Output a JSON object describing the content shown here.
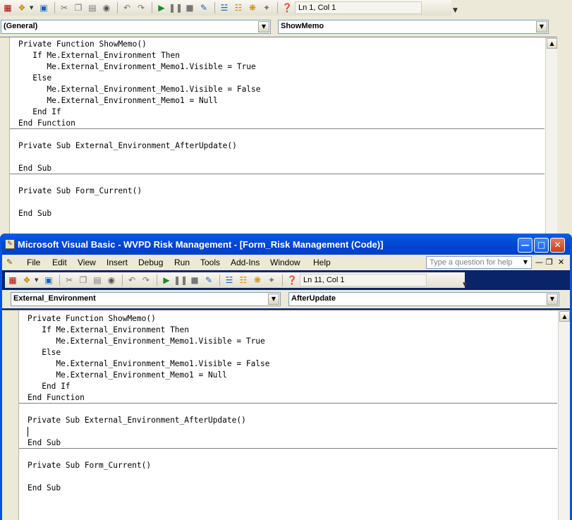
{
  "back_window": {
    "status": "Ln 1, Col 1",
    "object_combo": "(General)",
    "procedure_combo": "ShowMemo",
    "code_blocks": [
      "Private Function ShowMemo()\n   If Me.External_Environment Then\n      Me.External_Environment_Memo1.Visible = True\n   Else\n      Me.External_Environment_Memo1.Visible = False\n      Me.External_Environment_Memo1 = Null\n   End If\nEnd Function",
      "Private Sub External_Environment_AfterUpdate()\n\nEnd Sub",
      "Private Sub Form_Current()\n\nEnd Sub"
    ]
  },
  "front_window": {
    "title": "Microsoft Visual Basic - WVPD Risk Management - [Form_Risk Management (Code)]",
    "menu": [
      "File",
      "Edit",
      "View",
      "Insert",
      "Debug",
      "Run",
      "Tools",
      "Add-Ins",
      "Window",
      "Help"
    ],
    "help_placeholder": "Type a question for help",
    "status": "Ln 11, Col 1",
    "object_combo": "External_Environment",
    "procedure_combo": "AfterUpdate",
    "code_blocks": [
      "Private Function ShowMemo()\n   If Me.External_Environment Then\n      Me.External_Environment_Memo1.Visible = True\n   Else\n      Me.External_Environment_Memo1.Visible = False\n      Me.External_Environment_Memo1 = Null\n   End If\nEnd Function",
      "Private Sub External_Environment_AfterUpdate()\n\nEnd Sub",
      "Private Sub Form_Current()\n\nEnd Sub"
    ]
  },
  "toolbar_icons": [
    "access-icon",
    "insert-form-icon",
    "save-icon",
    "cut-icon",
    "copy-icon",
    "paste-icon",
    "find-icon",
    "undo-icon",
    "redo-icon",
    "run-icon",
    "break-icon",
    "reset-icon",
    "design-mode-icon",
    "project-explorer-icon",
    "properties-icon",
    "object-browser-icon",
    "toolbox-icon",
    "help-icon"
  ]
}
